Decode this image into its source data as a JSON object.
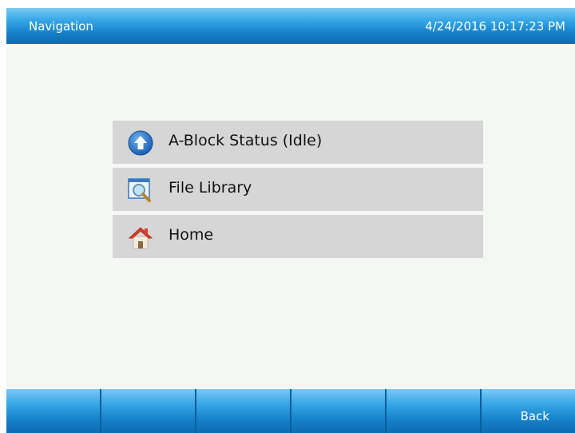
{
  "header": {
    "title": "Navigation",
    "datetime": "4/24/2016 10:17:23 PM"
  },
  "menu": {
    "items": [
      {
        "label": "A-Block Status (Idle)",
        "icon": "upload-arrow-icon"
      },
      {
        "label": "File Library",
        "icon": "magnifier-icon"
      },
      {
        "label": "Home",
        "icon": "home-icon"
      }
    ]
  },
  "footer": {
    "buttons": [
      "",
      "",
      "",
      "",
      "",
      "Back"
    ]
  },
  "colors": {
    "header_blue": "#1580c8",
    "menu_item_bg": "#d6d6d6",
    "content_bg": "#f4f7f4"
  }
}
